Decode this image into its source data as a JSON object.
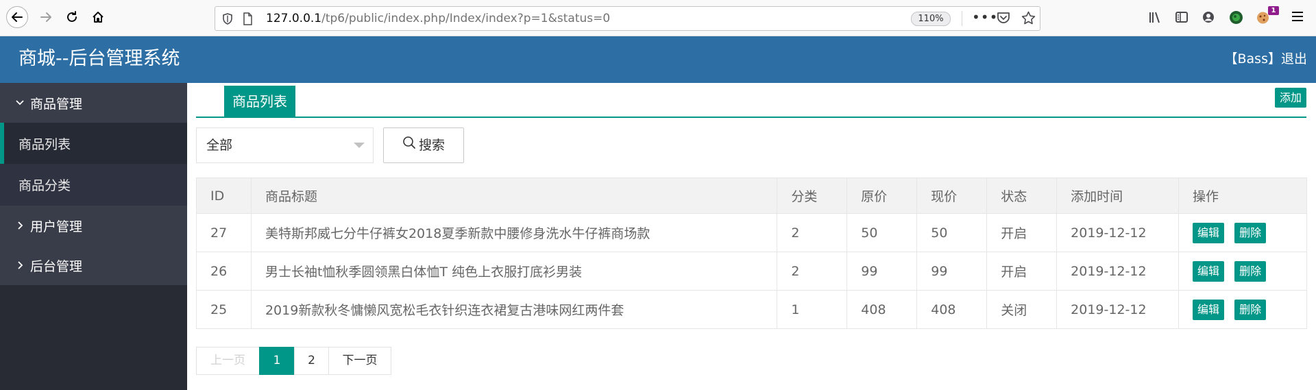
{
  "browser": {
    "url_host": "127.0.0.1",
    "url_path": "/tp6/public/index.php/Index/index?p=1&status=0",
    "zoom": "110%",
    "extension_badge": "1"
  },
  "header": {
    "title": "商城--后台管理系统",
    "user_label": "【Bass】",
    "logout_label": "退出"
  },
  "sidebar": {
    "group_goods": "商品管理",
    "item_goods_list": "商品列表",
    "item_goods_category": "商品分类",
    "group_users": "用户管理",
    "group_admin": "后台管理"
  },
  "main": {
    "tab_label": "商品列表",
    "add_label": "添加",
    "filter_value": "全部",
    "search_label": "搜索"
  },
  "table": {
    "headers": [
      "ID",
      "商品标题",
      "分类",
      "原价",
      "现价",
      "状态",
      "添加时间",
      "操作"
    ],
    "edit_label": "编辑",
    "delete_label": "删除",
    "rows": [
      {
        "id": "27",
        "title": "美特斯邦威七分牛仔裤女2018夏季新款中腰修身洗水牛仔裤商场款",
        "category": "2",
        "orig_price": "50",
        "price": "50",
        "status": "开启",
        "date": "2019-12-12"
      },
      {
        "id": "26",
        "title": "男士长袖t恤秋季圆领黑白体恤T 纯色上衣服打底衫男装",
        "category": "2",
        "orig_price": "99",
        "price": "99",
        "status": "开启",
        "date": "2019-12-12"
      },
      {
        "id": "25",
        "title": "2019新款秋冬慵懒风宽松毛衣针织连衣裙复古港味网红两件套",
        "category": "1",
        "orig_price": "408",
        "price": "408",
        "status": "关闭",
        "date": "2019-12-12"
      }
    ]
  },
  "pager": {
    "prev": "上一页",
    "pages": [
      "1",
      "2"
    ],
    "next": "下一页"
  },
  "colors": {
    "header_blue": "#2d6fa4",
    "accent_green": "#009688",
    "sidebar_dark": "#2a2e3a"
  }
}
